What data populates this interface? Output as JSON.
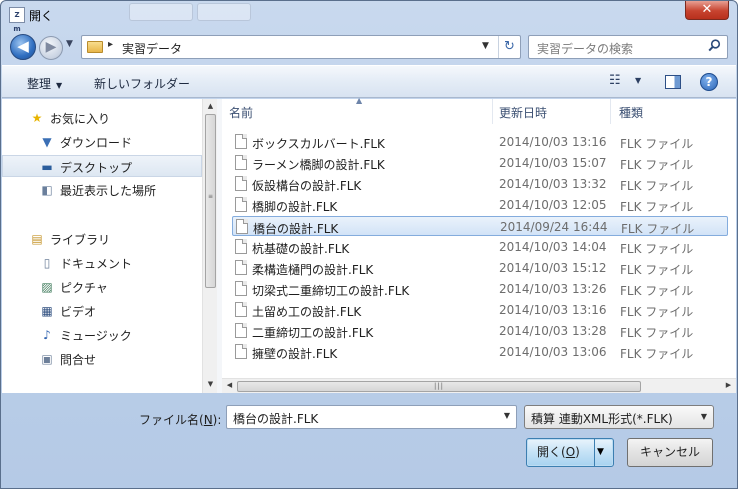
{
  "window": {
    "title": "開く",
    "app_icon_text": "Z m",
    "close_symbol": "✕"
  },
  "nav": {
    "back_symbol": "◀",
    "forward_symbol": "▶",
    "history_dropdown": "▼"
  },
  "address": {
    "separator": "▸",
    "path": "実習データ",
    "dropdown": "▼",
    "refresh_symbol": "↻"
  },
  "search": {
    "placeholder": "実習データの検索",
    "icon": "search-icon"
  },
  "toolbar": {
    "organize_label": "整理",
    "organize_arrow": "▼",
    "new_folder_label": "新しいフォルダー",
    "view_symbol": "☷",
    "view_dropdown": "▼",
    "help_symbol": "?"
  },
  "sidebar": {
    "items": [
      {
        "label": "お気に入り",
        "icon": "star-icon",
        "glyph": "★",
        "color": "#e8b400"
      },
      {
        "label": "ダウンロード",
        "icon": "download-folder-icon",
        "glyph": "▼",
        "color": "#3b6fb5"
      },
      {
        "label": "デスクトップ",
        "icon": "desktop-icon",
        "glyph": "▬",
        "color": "#2b5d9c"
      },
      {
        "label": "最近表示した場所",
        "icon": "recent-places-icon",
        "glyph": "◧",
        "color": "#6a7f9c"
      },
      {
        "label": "ライブラリ",
        "icon": "library-icon",
        "glyph": "▤",
        "color": "#c6962c"
      },
      {
        "label": "ドキュメント",
        "icon": "documents-icon",
        "glyph": "▯",
        "color": "#6d7f99"
      },
      {
        "label": "ピクチャ",
        "icon": "pictures-icon",
        "glyph": "▨",
        "color": "#3d7a5a"
      },
      {
        "label": "ビデオ",
        "icon": "videos-icon",
        "glyph": "▦",
        "color": "#2f4f7f"
      },
      {
        "label": "ミュージック",
        "icon": "music-icon",
        "glyph": "♪",
        "color": "#2f62b0"
      },
      {
        "label": "問合せ",
        "icon": "inquiry-icon",
        "glyph": "▣",
        "color": "#6d7f99"
      }
    ],
    "scroll_up": "▲",
    "scroll_down": "▼",
    "grip": "≡"
  },
  "columns": {
    "name": "名前",
    "date": "更新日時",
    "type": "種類",
    "sort_caret": "▲"
  },
  "files": [
    {
      "name": "ボックスカルバート.FLK",
      "date": "2014/10/03 13:16",
      "type": "FLK ファイル"
    },
    {
      "name": "ラーメン橋脚の設計.FLK",
      "date": "2014/10/03 15:07",
      "type": "FLK ファイル"
    },
    {
      "name": "仮設構台の設計.FLK",
      "date": "2014/10/03 13:32",
      "type": "FLK ファイル"
    },
    {
      "name": "橋脚の設計.FLK",
      "date": "2014/10/03 12:05",
      "type": "FLK ファイル"
    },
    {
      "name": "橋台の設計.FLK",
      "date": "2014/09/24 16:44",
      "type": "FLK ファイル",
      "selected": true
    },
    {
      "name": "杭基礎の設計.FLK",
      "date": "2014/10/03 14:04",
      "type": "FLK ファイル"
    },
    {
      "name": "柔構造樋門の設計.FLK",
      "date": "2014/10/03 15:12",
      "type": "FLK ファイル"
    },
    {
      "name": "切梁式二重締切工の設計.FLK",
      "date": "2014/10/03 13:26",
      "type": "FLK ファイル"
    },
    {
      "name": "土留め工の設計.FLK",
      "date": "2014/10/03 13:16",
      "type": "FLK ファイル"
    },
    {
      "name": "二重締切工の設計.FLK",
      "date": "2014/10/03 13:28",
      "type": "FLK ファイル"
    },
    {
      "name": "擁壁の設計.FLK",
      "date": "2014/10/03 13:06",
      "type": "FLK ファイル"
    }
  ],
  "hscroll": {
    "left": "◀",
    "right": "▶",
    "grip": "|||"
  },
  "bottom": {
    "filename_label": "ファイル名(",
    "filename_accel": "N",
    "filename_label_end": "):",
    "filename_value": "橋台の設計.FLK",
    "filename_dropdown": "▼",
    "filter_value": "積算 連動XML形式(*.FLK)",
    "filter_dropdown": "▼",
    "open_label": "開く(",
    "open_accel": "O",
    "open_label_end": ")",
    "open_split_arrow": "▼",
    "cancel_label": "キャンセル"
  }
}
